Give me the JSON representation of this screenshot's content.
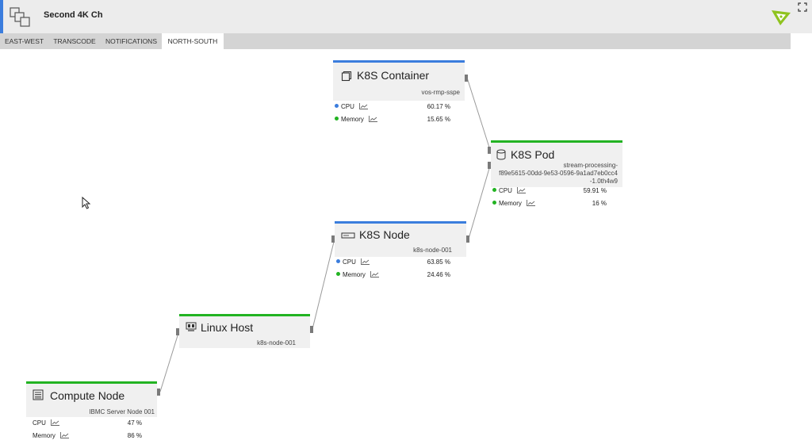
{
  "header": {
    "title": "Second 4K Ch",
    "app_icon": "topology-icon",
    "brand_icon": "brand-logo",
    "expand_icon": "expand-icon",
    "accent_color": "#3b7ddd",
    "brand_color": "#8fc31f"
  },
  "tabs": [
    {
      "label": "EAST-WEST",
      "active": false
    },
    {
      "label": "TRANSCODE",
      "active": false
    },
    {
      "label": "NOTIFICATIONS",
      "active": false
    },
    {
      "label": "NORTH-SOUTH",
      "active": true
    }
  ],
  "nodes": {
    "container": {
      "title": "K8S Container",
      "subtitle": "vos-rmp-sspe",
      "icon": "container-icon",
      "status_color": "#3b7ddd",
      "metrics": [
        {
          "label": "CPU",
          "value": "60.17 %",
          "dot_color": "#3b7ddd"
        },
        {
          "label": "Memory",
          "value": "15.65 %",
          "dot_color": "#22b322"
        }
      ]
    },
    "pod": {
      "title": "K8S Pod",
      "subtitle_lines": [
        "stream-processing-",
        "f89e5615-00dd-9e53-0596-9a1ad7eb0cc4",
        "-1.0th4w9"
      ],
      "icon": "pod-icon",
      "status_color": "#22b322",
      "metrics": [
        {
          "label": "CPU",
          "value": "59.91 %",
          "dot_color": "#22b322"
        },
        {
          "label": "Memory",
          "value": "16 %",
          "dot_color": "#22b322"
        }
      ]
    },
    "k8snode": {
      "title": "K8S Node",
      "subtitle": "k8s-node-001",
      "icon": "server-icon",
      "status_color": "#3b7ddd",
      "metrics": [
        {
          "label": "CPU",
          "value": "63.85 %",
          "dot_color": "#3b7ddd"
        },
        {
          "label": "Memory",
          "value": "24.46 %",
          "dot_color": "#22b322"
        }
      ]
    },
    "linuxhost": {
      "title": "Linux Host",
      "subtitle": "k8s-node-001",
      "icon": "linux-host-icon",
      "status_color": "#22b322"
    },
    "compute": {
      "title": "Compute Node",
      "subtitle": "IBMC Server Node 001",
      "icon": "compute-icon",
      "status_color": "#22b322",
      "metrics": [
        {
          "label": "CPU",
          "value": "47 %"
        },
        {
          "label": "Memory",
          "value": "86 %"
        }
      ]
    }
  },
  "link_color": "#9a9a9a"
}
